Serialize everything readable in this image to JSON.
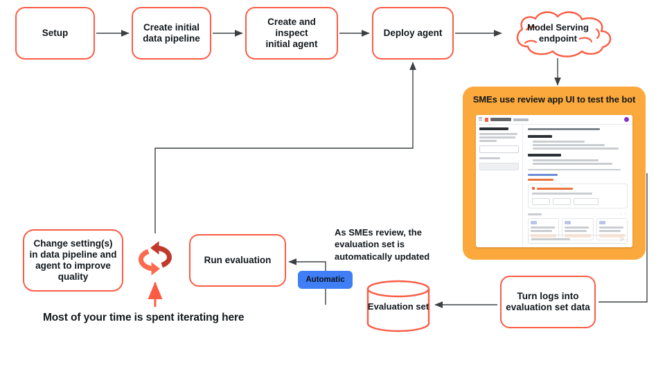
{
  "diagram": {
    "title_caption": "Most of your time is spent iterating here",
    "nodes": {
      "setup": "Setup",
      "create_pipeline": "Create initial\ndata pipeline",
      "create_inspect_agent": "Create and inspect\ninitial agent",
      "deploy_agent": "Deploy agent",
      "model_serving_endpoint": "Model Serving\nendpoint",
      "change_settings": "Change setting(s)\nin data pipeline and\nagent to improve\nquality",
      "run_evaluation": "Run evaluation",
      "evaluation_set": "Evaluation set",
      "turn_logs": "Turn logs into\nevaluation set data"
    },
    "panel": {
      "title": "SMEs use review app UI to test the bot"
    },
    "badge": {
      "automatic": "Automatic"
    },
    "annotations": {
      "sme_review": "As SMEs review, the\nevaluation set is\nautomatically updated"
    },
    "colors": {
      "node_border": "#FB5B43",
      "panel_background": "#FBA93C",
      "badge_background": "#3F7EF4",
      "connector": "#3C4043",
      "text": "#11171C",
      "loop_dark": "#C0392B",
      "loop_light": "#FB6B4F"
    }
  }
}
